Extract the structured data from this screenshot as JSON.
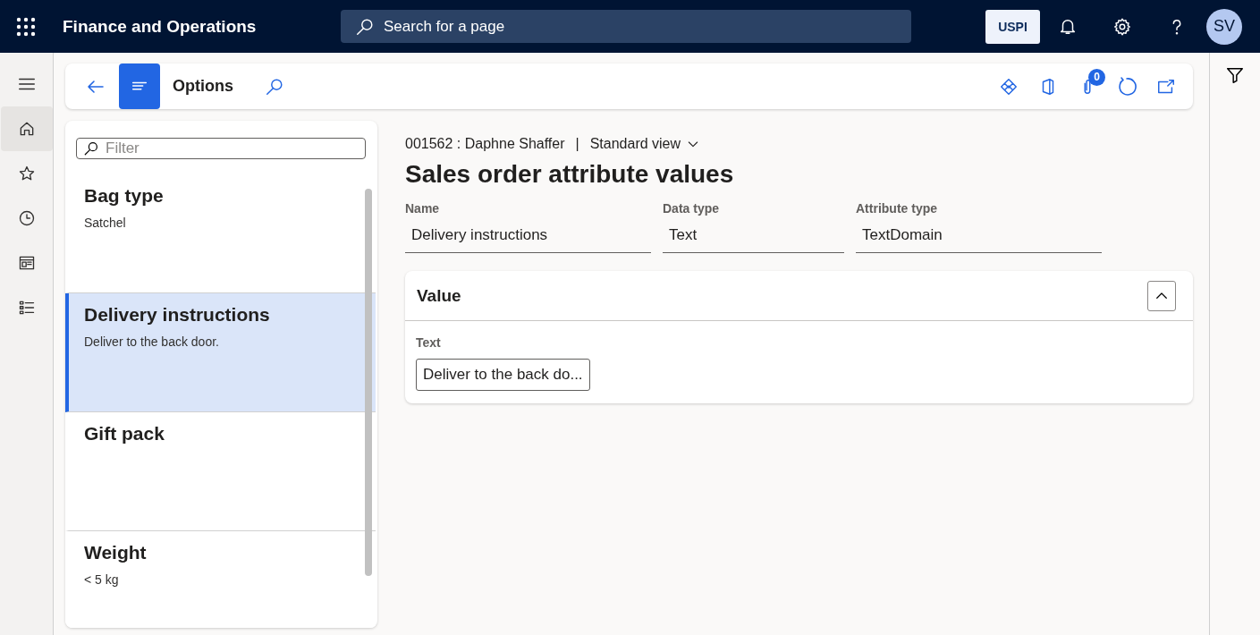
{
  "top_bar": {
    "app_title": "Finance and Operations",
    "search_placeholder": "Search for a page",
    "company": "USPI",
    "avatar": "SV"
  },
  "nav_items": [
    {
      "selected": true
    },
    {
      "selected": false
    },
    {
      "selected": false
    },
    {
      "selected": false
    },
    {
      "selected": false
    }
  ],
  "toolbar": {
    "title": "Options",
    "attachments_badge": "0"
  },
  "list": {
    "filter_placeholder": "Filter",
    "items": [
      {
        "title": "Bag type",
        "subtitle": "Satchel",
        "selected": false
      },
      {
        "title": "Delivery instructions",
        "subtitle": "Deliver to the back door.",
        "selected": true
      },
      {
        "title": "Gift pack",
        "selected": false
      },
      {
        "title": "Weight",
        "subtitle": "< 5 kg",
        "selected": false
      }
    ]
  },
  "detail": {
    "record": "001562 : Daphne Shaffer",
    "separator": "|",
    "view": "Standard view",
    "title": "Sales order attribute values",
    "fields": [
      {
        "label": "Name",
        "value": "Delivery instructions"
      },
      {
        "label": "Data type",
        "value": "Text"
      },
      {
        "label": "Attribute type",
        "value": "TextDomain"
      }
    ],
    "value_section": {
      "title": "Value",
      "expanded": true,
      "field_label": "Text",
      "field_value": "Deliver to the back do..."
    }
  }
}
